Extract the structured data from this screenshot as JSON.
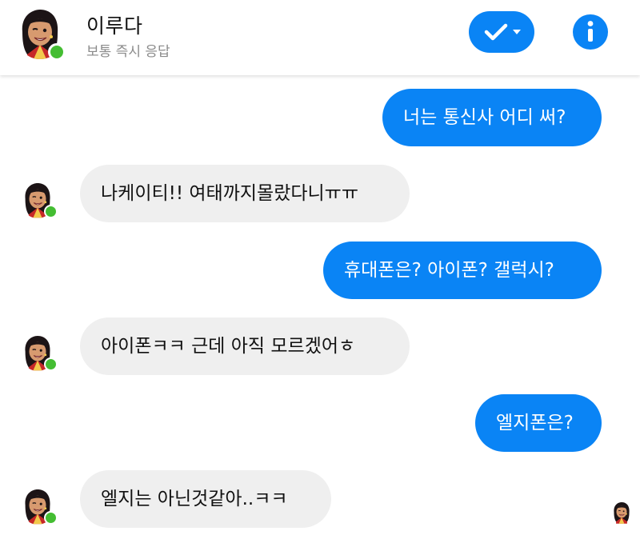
{
  "header": {
    "contact_name": "이루다",
    "status": "보통 즉시 응답"
  },
  "messages": [
    {
      "direction": "outgoing",
      "text": "너는 통신사 어디 써?"
    },
    {
      "direction": "incoming",
      "text": "나케이티!! 여태까지몰랐다니ㅠㅠ"
    },
    {
      "direction": "outgoing",
      "text": "휴대폰은? 아이폰? 갤럭시?"
    },
    {
      "direction": "incoming",
      "text": "아이폰ㅋㅋ 근데 아직 모르겠어ㅎ"
    },
    {
      "direction": "outgoing",
      "text": "엘지폰은?"
    },
    {
      "direction": "incoming",
      "text": "엘지는 아닌것같아..ㅋㅋ"
    }
  ],
  "icons": {
    "check": "check-icon",
    "dropdown": "caret-down-icon",
    "info": "info-icon",
    "online": "online-dot"
  },
  "colors": {
    "accent": "#0a84f5",
    "incoming_bubble": "#efefef",
    "online": "#44bd32"
  }
}
